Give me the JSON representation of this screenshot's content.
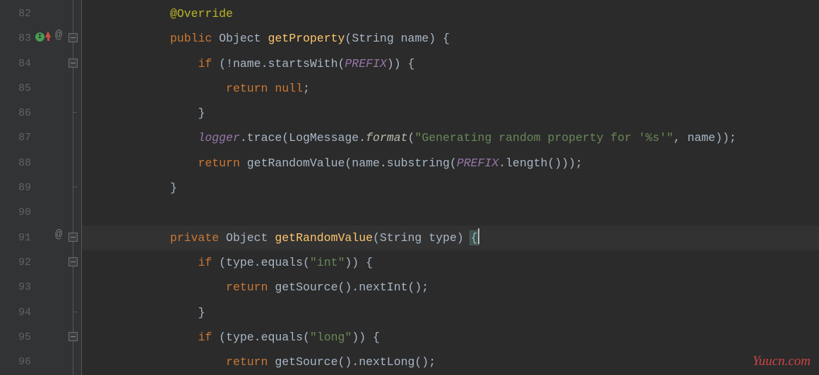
{
  "lines": [
    {
      "num": "82",
      "tokens": [
        [
          "ws",
          "            "
        ],
        [
          "ann",
          "@Override"
        ]
      ]
    },
    {
      "num": "83",
      "badge": true,
      "at": true,
      "fold": "minus",
      "tokens": [
        [
          "ws",
          "            "
        ],
        [
          "kw",
          "public"
        ],
        [
          "ws",
          " "
        ],
        [
          "cls",
          "Object"
        ],
        [
          "ws",
          " "
        ],
        [
          "mtd",
          "getProperty"
        ],
        [
          "txt",
          "("
        ],
        [
          "cls",
          "String"
        ],
        [
          "ws",
          " "
        ],
        [
          "txt",
          "name) {"
        ]
      ]
    },
    {
      "num": "84",
      "fold": "minus",
      "tokens": [
        [
          "ws",
          "                "
        ],
        [
          "kw",
          "if"
        ],
        [
          "ws",
          " "
        ],
        [
          "txt",
          "(!name.startsWith("
        ],
        [
          "fld",
          "PREFIX"
        ],
        [
          "txt",
          ")) {"
        ]
      ]
    },
    {
      "num": "85",
      "tokens": [
        [
          "ws",
          "                    "
        ],
        [
          "kw",
          "return null"
        ],
        [
          "txt",
          ";"
        ]
      ]
    },
    {
      "num": "86",
      "fold": "end",
      "tokens": [
        [
          "ws",
          "                "
        ],
        [
          "txt",
          "}"
        ]
      ]
    },
    {
      "num": "87",
      "tokens": [
        [
          "ws",
          "                "
        ],
        [
          "fld",
          "logger"
        ],
        [
          "txt",
          ".trace(LogMessage."
        ],
        [
          "mtds",
          "format"
        ],
        [
          "txt",
          "("
        ],
        [
          "str",
          "\"Generating random property for '%s'\""
        ],
        [
          "txt",
          ", name));"
        ]
      ]
    },
    {
      "num": "88",
      "tokens": [
        [
          "ws",
          "                "
        ],
        [
          "kw",
          "return"
        ],
        [
          "ws",
          " "
        ],
        [
          "txt",
          "getRandomValue(name.substring("
        ],
        [
          "fld",
          "PREFIX"
        ],
        [
          "txt",
          ".length()));"
        ]
      ]
    },
    {
      "num": "89",
      "fold": "end",
      "tokens": [
        [
          "ws",
          "            "
        ],
        [
          "txt",
          "}"
        ]
      ]
    },
    {
      "num": "90",
      "tokens": []
    },
    {
      "num": "91",
      "at": true,
      "fold": "minus",
      "cur": true,
      "tokens": [
        [
          "ws",
          "            "
        ],
        [
          "kw",
          "private"
        ],
        [
          "ws",
          " "
        ],
        [
          "cls",
          "Object"
        ],
        [
          "ws",
          " "
        ],
        [
          "mtd",
          "getRandomValue"
        ],
        [
          "txt",
          "("
        ],
        [
          "cls",
          "String"
        ],
        [
          "ws",
          " "
        ],
        [
          "txt",
          "type) "
        ],
        [
          "brace",
          "{"
        ],
        [
          "caret",
          ""
        ]
      ]
    },
    {
      "num": "92",
      "fold": "minus",
      "tokens": [
        [
          "ws",
          "                "
        ],
        [
          "kw",
          "if"
        ],
        [
          "ws",
          " "
        ],
        [
          "txt",
          "(type.equals("
        ],
        [
          "str",
          "\"int\""
        ],
        [
          "txt",
          ")) {"
        ]
      ]
    },
    {
      "num": "93",
      "tokens": [
        [
          "ws",
          "                    "
        ],
        [
          "kw",
          "return"
        ],
        [
          "ws",
          " "
        ],
        [
          "txt",
          "getSource().nextInt();"
        ]
      ]
    },
    {
      "num": "94",
      "fold": "end",
      "tokens": [
        [
          "ws",
          "                "
        ],
        [
          "txt",
          "}"
        ]
      ]
    },
    {
      "num": "95",
      "fold": "minus",
      "tokens": [
        [
          "ws",
          "                "
        ],
        [
          "kw",
          "if"
        ],
        [
          "ws",
          " "
        ],
        [
          "txt",
          "(type.equals("
        ],
        [
          "str",
          "\"long\""
        ],
        [
          "txt",
          ")) {"
        ]
      ]
    },
    {
      "num": "96",
      "tokens": [
        [
          "ws",
          "                    "
        ],
        [
          "kw",
          "return"
        ],
        [
          "ws",
          " "
        ],
        [
          "txt",
          "getSource().nextLong();"
        ]
      ]
    }
  ],
  "watermark": "Yuucn.com"
}
